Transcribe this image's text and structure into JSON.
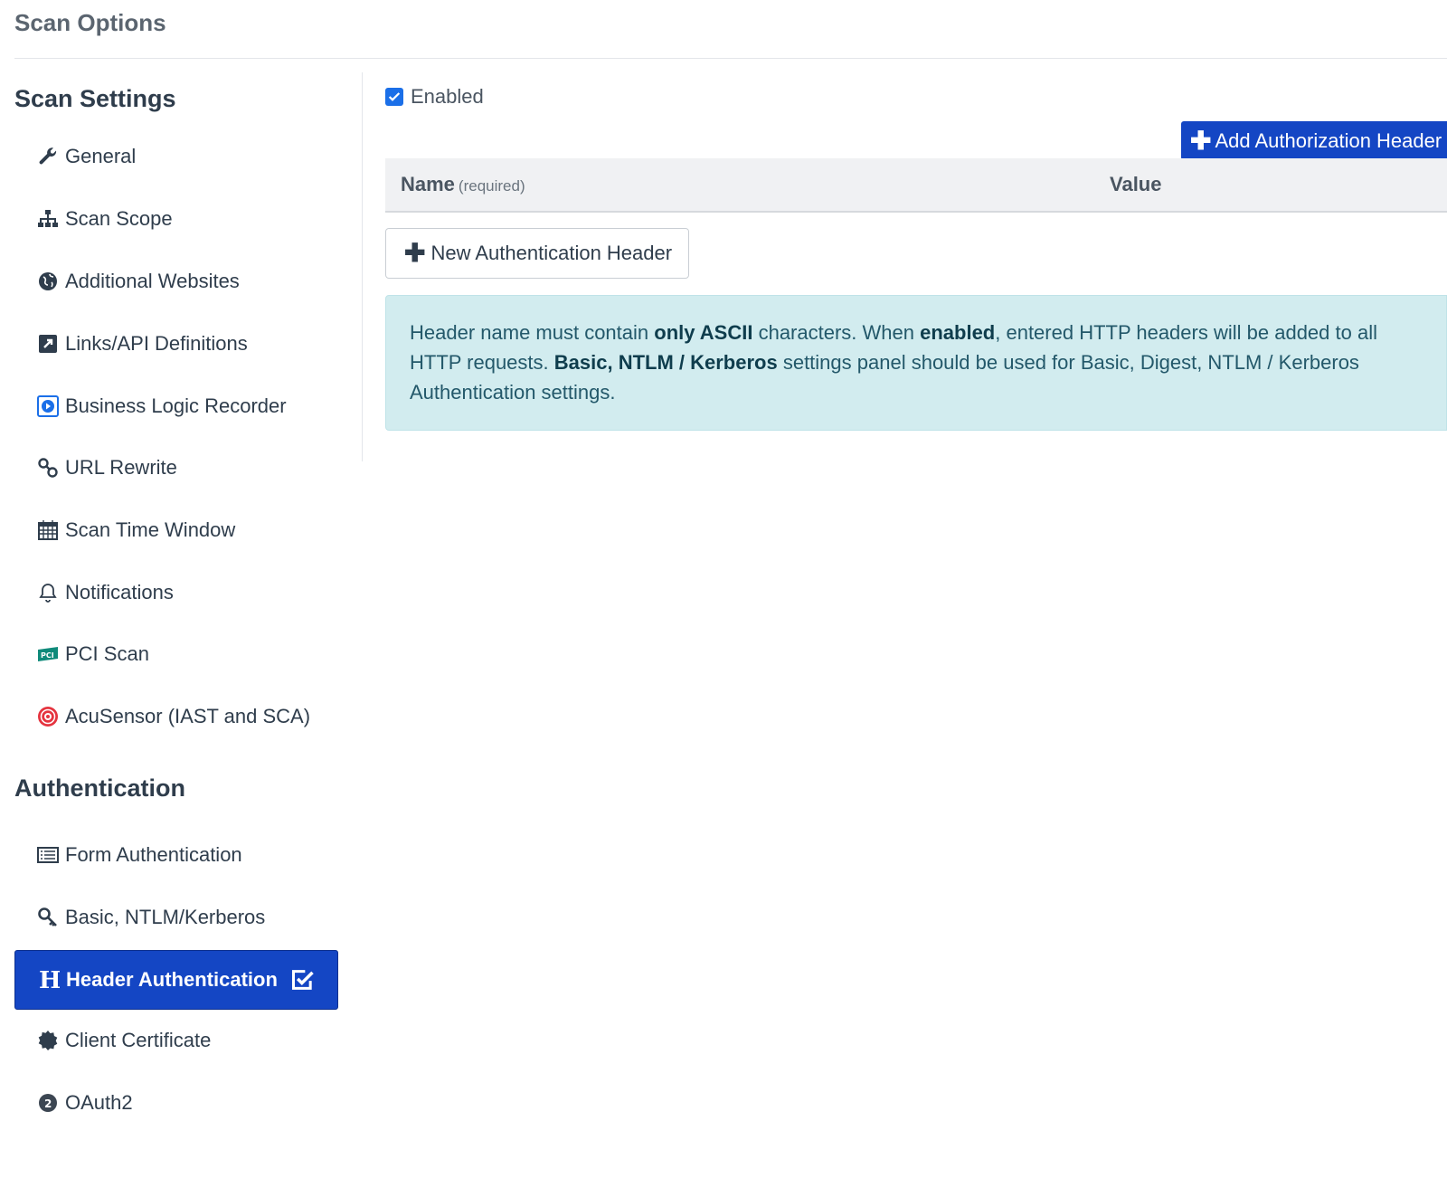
{
  "page": {
    "title": "Scan Options"
  },
  "sidebar": {
    "scan_settings_heading": "Scan Settings",
    "scan_settings": [
      {
        "label": "General",
        "icon": "wrench-icon"
      },
      {
        "label": "Scan Scope",
        "icon": "sitemap-icon"
      },
      {
        "label": "Additional Websites",
        "icon": "globe-icon"
      },
      {
        "label": "Links/API Definitions",
        "icon": "external-link-icon"
      },
      {
        "label": "Business Logic Recorder",
        "icon": "play-icon"
      },
      {
        "label": "URL Rewrite",
        "icon": "link-icon"
      },
      {
        "label": "Scan Time Window",
        "icon": "calendar-icon"
      },
      {
        "label": "Notifications",
        "icon": "bell-icon"
      },
      {
        "label": "PCI Scan",
        "icon": "pci-icon"
      },
      {
        "label": "AcuSensor (IAST and SCA)",
        "icon": "acusensor-icon"
      }
    ],
    "authentication_heading": "Authentication",
    "authentication": [
      {
        "label": "Form Authentication",
        "icon": "form-icon"
      },
      {
        "label": "Basic, NTLM/Kerberos",
        "icon": "key-icon"
      },
      {
        "label": "Header Authentication",
        "icon": "header-h-icon",
        "active": true
      },
      {
        "label": "Client Certificate",
        "icon": "certificate-icon"
      },
      {
        "label": "OAuth2",
        "icon": "oauth2-icon"
      }
    ]
  },
  "main": {
    "enabled_label": "Enabled",
    "enabled_checked": true,
    "add_button_label": "Add Authorization Header",
    "table": {
      "name_header": "Name",
      "name_hint": "(required)",
      "value_header": "Value"
    },
    "new_header_button_label": "New Authentication Header",
    "info": {
      "p1": "Header name must contain ",
      "b1": "only ASCII",
      "p2": " characters. When ",
      "b2": "enabled",
      "p3": ", entered HTTP headers will be added to all HTTP requests. ",
      "b3": "Basic, NTLM / Kerberos",
      "p4": " settings panel should be used for Basic, Digest, NTLM / Kerberos Authentication settings."
    }
  },
  "colors": {
    "accent": "#1446c4",
    "info_bg": "#d2ecef",
    "text": "#2f3d4c"
  }
}
